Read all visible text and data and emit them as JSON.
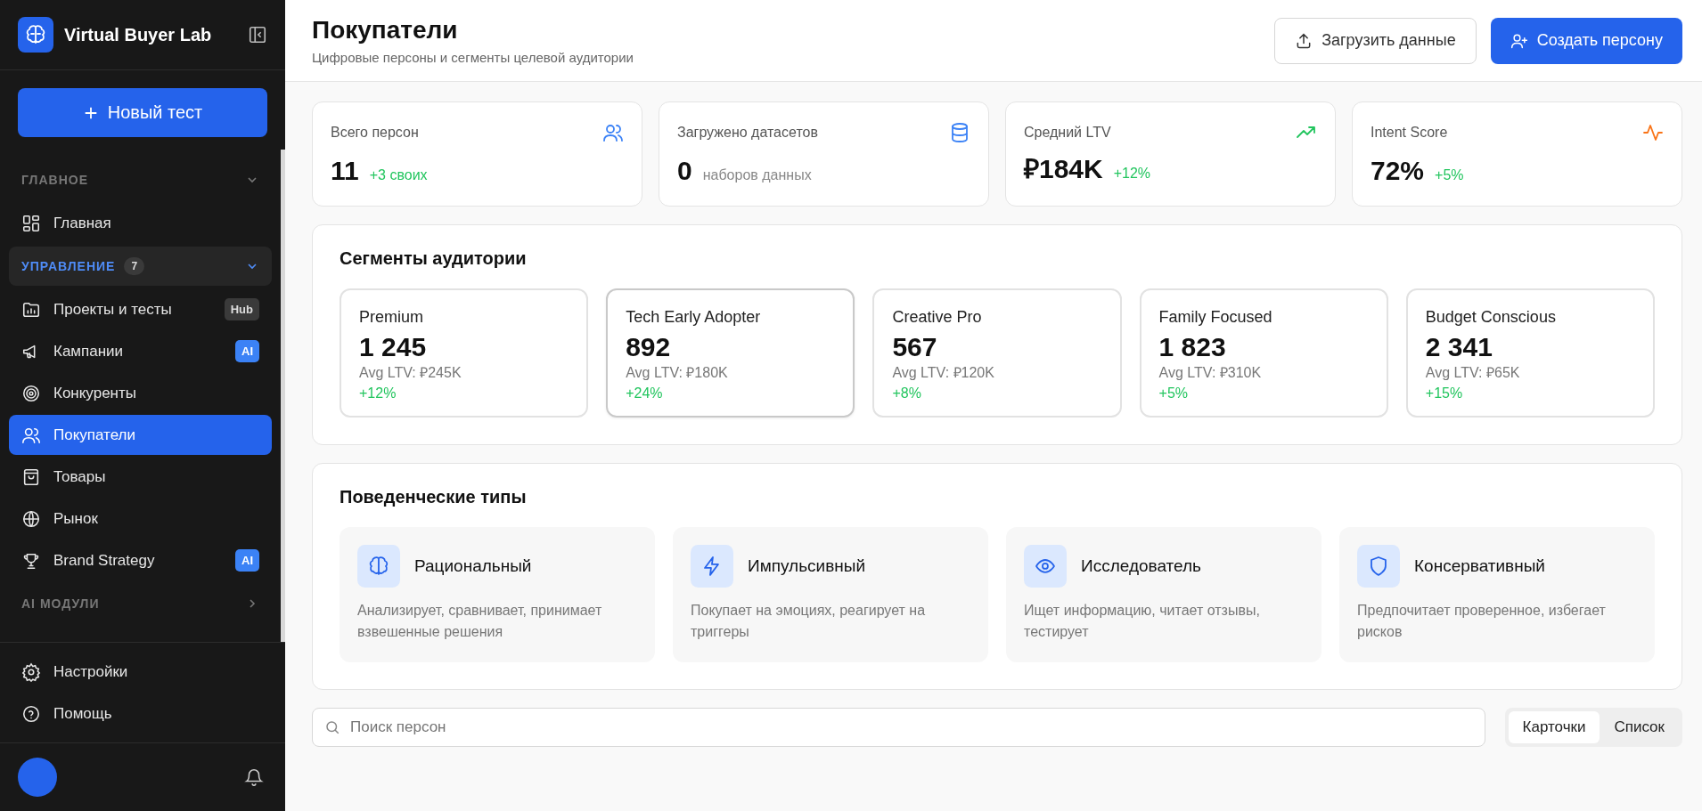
{
  "sidebar": {
    "brand": "Virtual Buyer Lab",
    "new_button": "Новый тест",
    "sections": [
      {
        "title": "ГЛАВНОЕ",
        "expanded": true,
        "active": false,
        "items": [
          {
            "label": "Главная",
            "selected": false
          }
        ]
      },
      {
        "title": "УПРАВЛЕНИЕ",
        "count": "7",
        "expanded": true,
        "active": true,
        "items": [
          {
            "label": "Проекты и тесты",
            "selected": false,
            "badge": {
              "text": "Hub",
              "kind": "neutral"
            }
          },
          {
            "label": "Кампании",
            "selected": false,
            "badge": {
              "text": "AI",
              "kind": "accent"
            }
          },
          {
            "label": "Конкуренты",
            "selected": false
          },
          {
            "label": "Покупатели",
            "selected": true
          },
          {
            "label": "Товары",
            "selected": false
          },
          {
            "label": "Рынок",
            "selected": false
          },
          {
            "label": "Brand Strategy",
            "selected": false,
            "badge": {
              "text": "AI",
              "kind": "accent"
            }
          }
        ]
      },
      {
        "title": "AI МОДУЛИ",
        "expanded": false,
        "active": false
      }
    ],
    "footer_items": [
      "Настройки",
      "Помощь"
    ]
  },
  "header": {
    "title": "Покупатели",
    "subtitle": "Цифровые персоны и сегменты целевой аудитории",
    "buttons": [
      {
        "label": "Загрузить данные",
        "kind": "secondary"
      },
      {
        "label": "Создать персону",
        "kind": "primary"
      }
    ]
  },
  "stats": [
    {
      "label": "Всего персон",
      "value": "11",
      "note": "+3 своих",
      "kind": "positive"
    },
    {
      "label": "Загружено датасетов",
      "value": "0",
      "note": "наборов данных",
      "kind": "muted"
    },
    {
      "label": "Средний LTV",
      "value": "₽184K",
      "note": "+12%",
      "kind": "positive"
    },
    {
      "label": "Intent Score",
      "value": "72%",
      "note": "+5%",
      "kind": "positive"
    }
  ],
  "segments": {
    "title": "Сегменты аудитории",
    "items": [
      {
        "name": "Premium",
        "count": "1 245",
        "ltv": "Avg LTV: ₽245K",
        "change": "+12%",
        "selected": false
      },
      {
        "name": "Tech Early Adopter",
        "count": "892",
        "ltv": "Avg LTV: ₽180K",
        "change": "+24%",
        "selected": true
      },
      {
        "name": "Creative Pro",
        "count": "567",
        "ltv": "Avg LTV: ₽120K",
        "change": "+8%",
        "selected": false
      },
      {
        "name": "Family Focused",
        "count": "1 823",
        "ltv": "Avg LTV: ₽310K",
        "change": "+5%",
        "selected": false
      },
      {
        "name": "Budget Conscious",
        "count": "2 341",
        "ltv": "Avg LTV: ₽65K",
        "change": "+15%",
        "selected": false
      }
    ]
  },
  "behavior": {
    "title": "Поведенческие типы",
    "items": [
      {
        "name": "Рациональный",
        "description": "Анализирует, сравнивает, принимает взвешенные решения"
      },
      {
        "name": "Импульсивный",
        "description": "Покупает на эмоциях, реагирует на триггеры"
      },
      {
        "name": "Исследователь",
        "description": "Ищет информацию, читает отзывы, тестирует"
      },
      {
        "name": "Консервативный",
        "description": "Предпочитает проверенное, избегает рисков"
      }
    ]
  },
  "search": {
    "placeholder": "Поиск персон"
  },
  "view_toggle": [
    {
      "label": "Карточки",
      "selected": true
    },
    {
      "label": "Список",
      "selected": false
    }
  ]
}
